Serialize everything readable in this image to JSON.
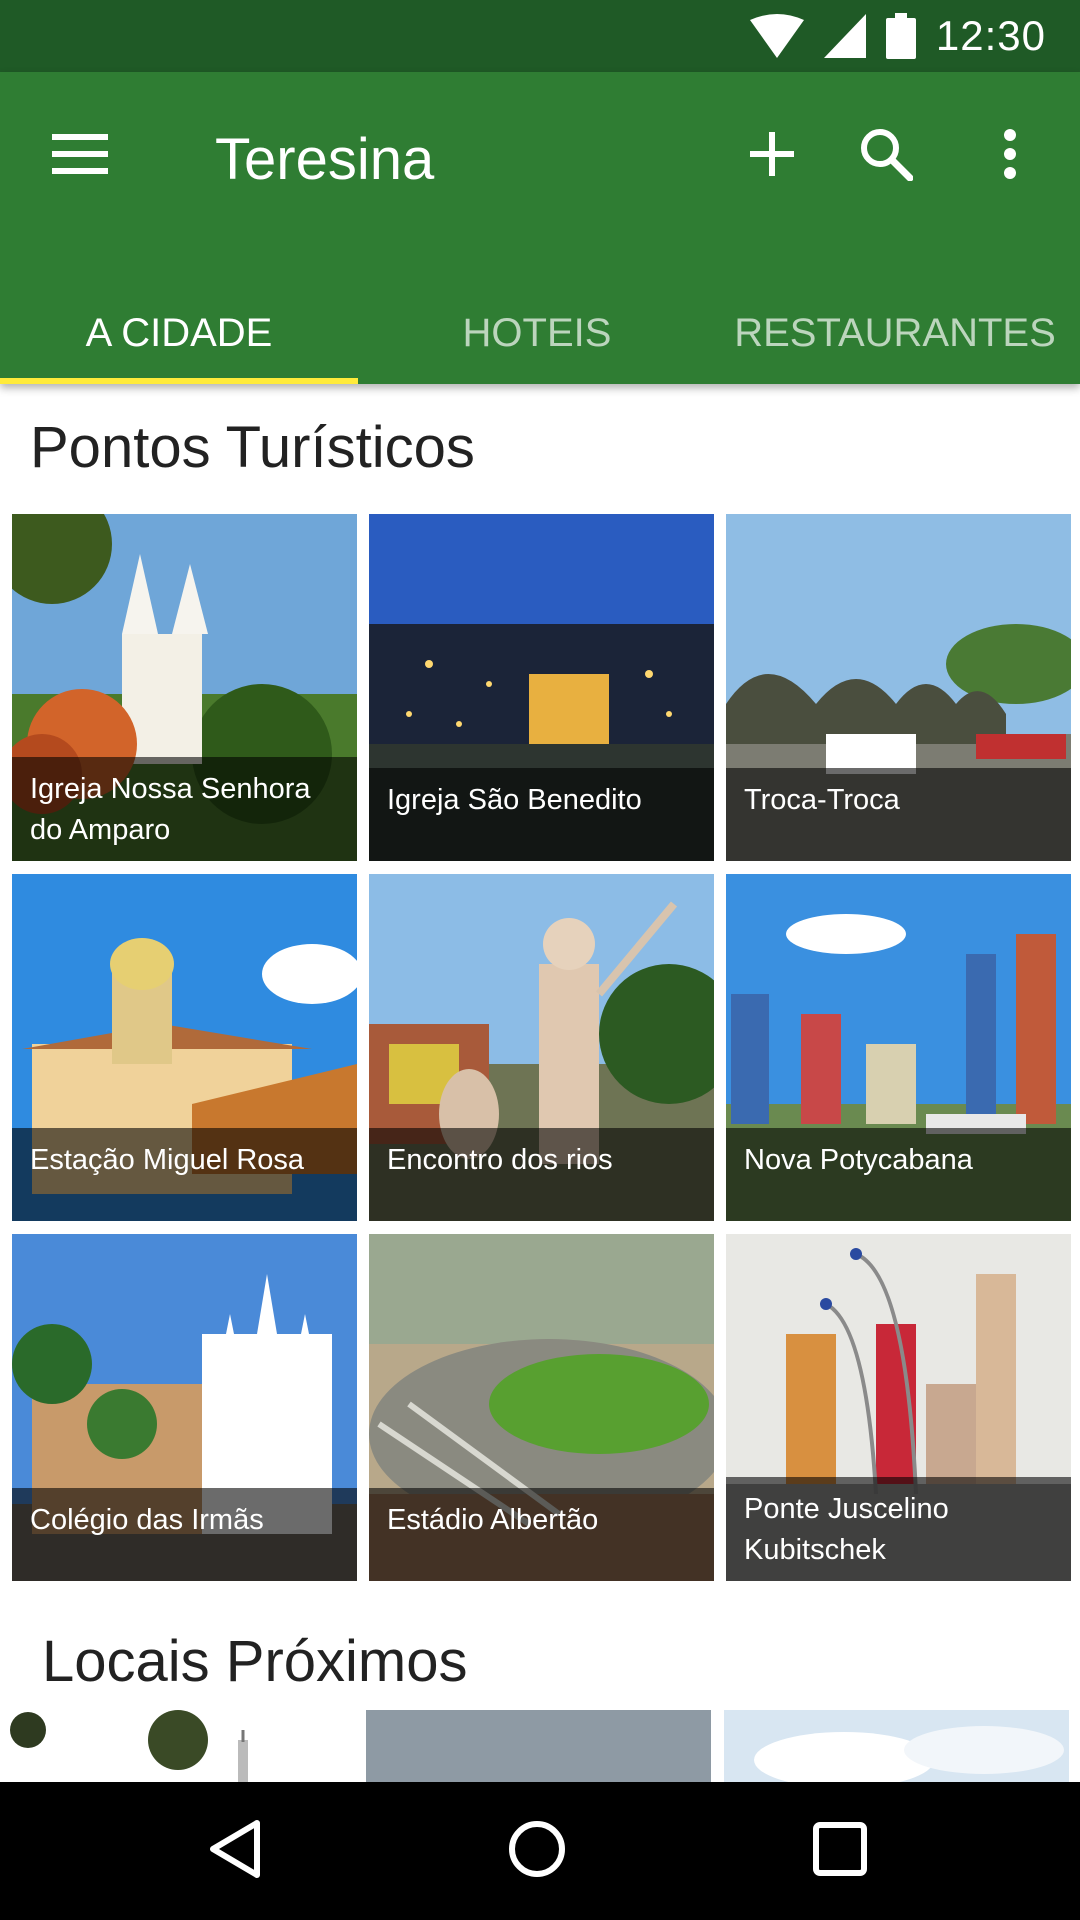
{
  "status_bar": {
    "time": "12:30",
    "icons": [
      "wifi-icon",
      "cell-signal-icon",
      "battery-icon"
    ]
  },
  "app_bar": {
    "title": "Teresina",
    "icons": [
      "menu-icon",
      "add-icon",
      "search-icon",
      "more-vert-icon"
    ],
    "color": "#2f7d33"
  },
  "tabs": [
    {
      "label": "A CIDADE",
      "active": true
    },
    {
      "label": "HOTEIS",
      "active": false
    },
    {
      "label": "RESTAURANTES",
      "active": false
    }
  ],
  "tab_indicator_color": "#ffeb3b",
  "sections": {
    "tourist_spots": {
      "title": "Pontos Turísticos",
      "items": [
        {
          "label": "Igreja Nossa Senhora do Amparo"
        },
        {
          "label": "Igreja São Benedito"
        },
        {
          "label": "Troca-Troca"
        },
        {
          "label": "Estação Miguel Rosa"
        },
        {
          "label": "Encontro dos rios"
        },
        {
          "label": "Nova Potycabana"
        },
        {
          "label": "Colégio das Irmãs"
        },
        {
          "label": "Estádio Albertão"
        },
        {
          "label": "Ponte Juscelino Kubitschek"
        }
      ]
    },
    "nearby": {
      "title": "Locais Próximos"
    }
  },
  "nav_bar": {
    "icons": [
      "back-icon",
      "home-icon",
      "recents-icon"
    ]
  }
}
